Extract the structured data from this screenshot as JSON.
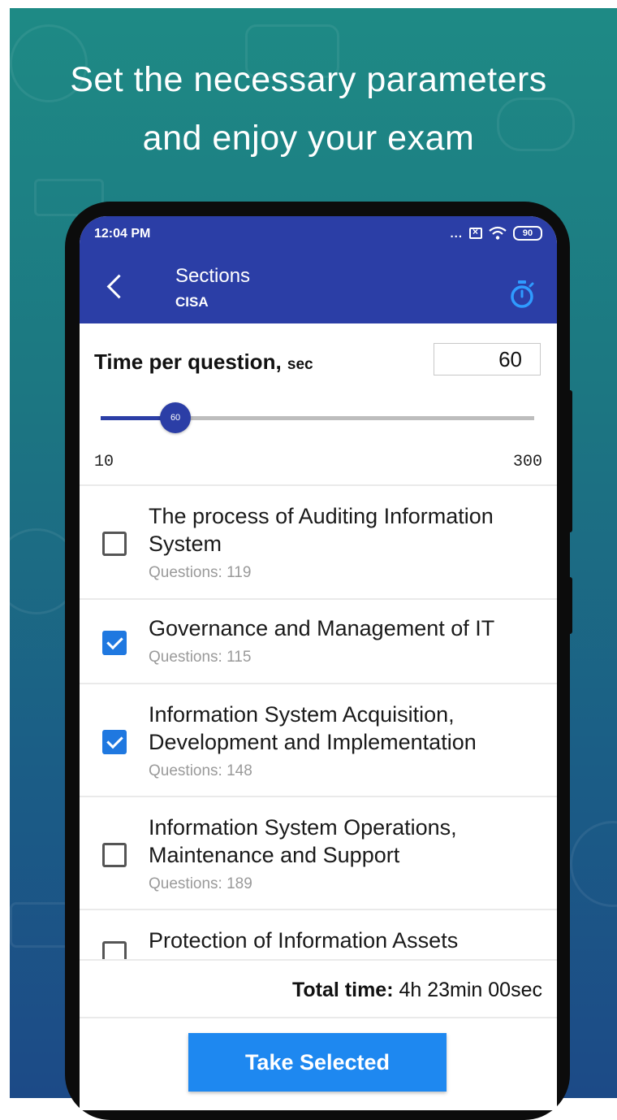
{
  "promo": {
    "headline_line1": "Set the necessary parameters",
    "headline_line2": "and enjoy your exam"
  },
  "status_bar": {
    "time": "12:04 PM",
    "dots": "...",
    "battery": "90"
  },
  "app_bar": {
    "title": "Sections",
    "subtitle": "CISA",
    "back_icon": "chevron-left-icon",
    "right_icon": "stopwatch-icon"
  },
  "time_per_question": {
    "label": "Time per question,",
    "unit": "sec",
    "value": "60",
    "slider_value": 60,
    "slider_min": "10",
    "slider_max": "300"
  },
  "sections": [
    {
      "title": "The process of Auditing Information System",
      "count": "Questions: 119",
      "checked": false
    },
    {
      "title": "Governance and Management of IT",
      "count": "Questions: 115",
      "checked": true
    },
    {
      "title": "Information System Acquisition, Development and Implementation",
      "count": "Questions: 148",
      "checked": true
    },
    {
      "title": "Information System Operations, Maintenance and Support",
      "count": "Questions: 189",
      "checked": false
    },
    {
      "title": "Protection of Information Assets",
      "count": "",
      "checked": false
    }
  ],
  "total": {
    "label": "Total time:",
    "value": "4h 23min 00sec"
  },
  "actions": {
    "take_selected": "Take Selected"
  },
  "colors": {
    "primary": "#2b3ea6",
    "accent": "#1e88f0",
    "checkbox_checked": "#1f78e0",
    "background_top": "#1e8a85",
    "background_bottom": "#1c4a87"
  }
}
